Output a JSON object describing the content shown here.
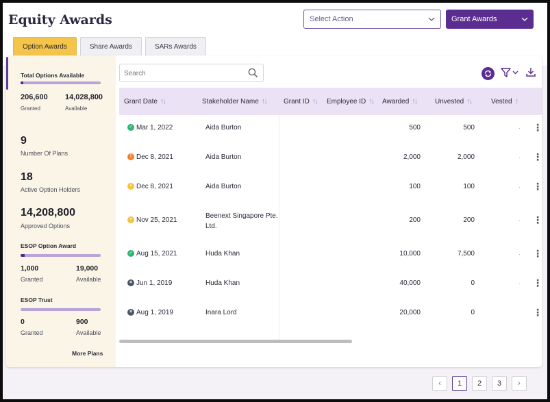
{
  "header": {
    "title": "Equity Awards",
    "select_action": "Select Action",
    "grant_awards": "Grant Awards"
  },
  "tabs": [
    {
      "label": "Option Awards",
      "active": true
    },
    {
      "label": "Share Awards",
      "active": false
    },
    {
      "label": "SARs Awards",
      "active": false
    }
  ],
  "summary": {
    "total_heading": "Total Options Available",
    "granted_value": "206,600",
    "granted_label": "Granted",
    "available_value": "14,028,800",
    "available_label": "Available",
    "plans_value": "9",
    "plans_label": "Number Of Plans",
    "holders_value": "18",
    "holders_label": "Active Option Holders",
    "approved_value": "14,208,800",
    "approved_label": "Approved Options",
    "plans": [
      {
        "name": "ESOP Option Award",
        "granted": "1,000",
        "granted_label": "Granted",
        "available": "19,000",
        "available_label": "Available",
        "granted_fraction": 0.05
      },
      {
        "name": "ESOP Trust",
        "granted": "0",
        "granted_label": "Granted",
        "available": "900",
        "available_label": "Available",
        "granted_fraction": 0.0
      }
    ],
    "more_plans": "More Plans"
  },
  "search": {
    "placeholder": "Search"
  },
  "table": {
    "columns": [
      "Grant Date",
      "Stakeholder Name",
      "Grant ID",
      "Employee ID",
      "Awarded",
      "Unvested",
      "Vested"
    ],
    "rows": [
      {
        "status": "green",
        "date": "Mar 1, 2022",
        "name": "Aida Burton",
        "awarded": "500",
        "unvested": "500"
      },
      {
        "status": "orange",
        "date": "Dec 8, 2021",
        "name": "Aida Burton",
        "awarded": "2,000",
        "unvested": "2,000"
      },
      {
        "status": "yellow",
        "date": "Dec 8, 2021",
        "name": "Aida Burton",
        "awarded": "100",
        "unvested": "100"
      },
      {
        "status": "yellow",
        "date": "Nov 25, 2021",
        "name": "Beenext Singapore Pte. Ltd.",
        "awarded": "200",
        "unvested": "200"
      },
      {
        "status": "green",
        "date": "Aug 15, 2021",
        "name": "Huda Khan",
        "awarded": "10,000",
        "unvested": "7,500"
      },
      {
        "status": "gray",
        "date": "Jun 1, 2019",
        "name": "Huda Khan",
        "awarded": "40,000",
        "unvested": "0"
      },
      {
        "status": "gray",
        "date": "Aug 1, 2019",
        "name": "Inara Lord",
        "awarded": "20,000",
        "unvested": "0"
      }
    ]
  },
  "pagination": {
    "pages": [
      "1",
      "2",
      "3"
    ],
    "current": "1",
    "prev": "‹",
    "next": "›"
  },
  "colors": {
    "accent": "#5b2d91",
    "tab_active": "#f5c44a",
    "header_row": "#ebe3f5",
    "panel": "#fbf5e8"
  },
  "icons": {
    "search": "magnifier-icon",
    "refresh": "refresh-icon",
    "filter": "filter-icon",
    "download": "download-icon"
  }
}
